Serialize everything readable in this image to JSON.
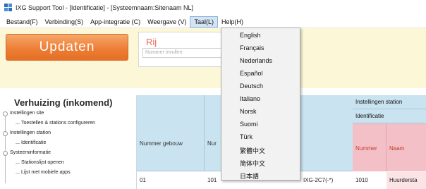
{
  "window": {
    "title": "IXG Support Tool - [Identificatie] - [Systeemnaam:Sitenaam NL]"
  },
  "menubar": {
    "items": [
      "Bestand(F)",
      "Verbinding(S)",
      "App-integratie (C)",
      "Weergave (V)",
      "Taal(L)",
      "Help(H)"
    ],
    "active_index": 4
  },
  "toolbar": {
    "update_label": "Updaten",
    "row_label": "Rij",
    "row_input_placeholder": "Nummer invullen",
    "accent_color": "#ee7f36"
  },
  "language_menu": {
    "items": [
      "English",
      "Français",
      "Nederlands",
      "Español",
      "Deutsch",
      "Italiano",
      "Norsk",
      "Suomi",
      "Türk",
      "繁體中文",
      "简体中文",
      "日本語"
    ]
  },
  "sidebar": {
    "title": "Verhuizing (inkomend)",
    "items": [
      {
        "label": "Instellingen site",
        "level": 0
      },
      {
        "label": "Toestellen & stations configureren",
        "level": 1
      },
      {
        "label": "Instellingen station",
        "level": 0
      },
      {
        "label": "Identificatie",
        "level": 1
      },
      {
        "label": "Systeeminformatie",
        "level": 0
      },
      {
        "label": "Stationslijst openen",
        "level": 1
      },
      {
        "label": "Lijst met mobiele apps",
        "level": 1
      }
    ]
  },
  "grid": {
    "columns": [
      "Nummer gebouw",
      "Nur"
    ],
    "group_header": "Instellingen station",
    "subgroup_header": "Identificatie",
    "sub_columns": [
      "Nummer",
      "Naam"
    ],
    "rows": [
      {
        "building": "01",
        "unit": "101",
        "type": "IXG-2C7(-*)",
        "number": "1010",
        "name": "Huurdersta"
      }
    ]
  }
}
